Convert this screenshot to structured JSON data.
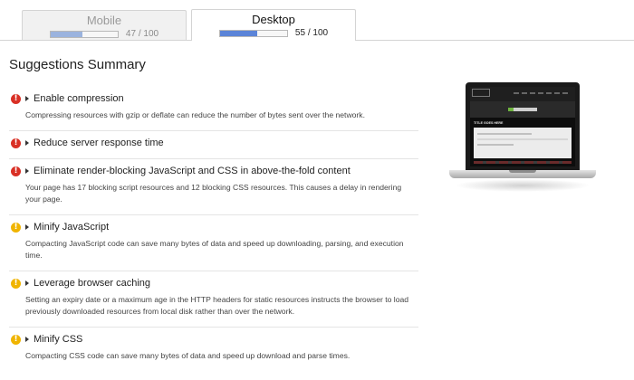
{
  "tabs": [
    {
      "label": "Mobile",
      "score_text": "47 / 100",
      "score": 47,
      "active": false
    },
    {
      "label": "Desktop",
      "score_text": "55 / 100",
      "score": 55,
      "active": true
    }
  ],
  "summary_title": "Suggestions Summary",
  "suggestions": [
    {
      "priority": "high",
      "icon": "!",
      "title": "Enable compression",
      "description": "Compressing resources with gzip or deflate can reduce the number of bytes sent over the network."
    },
    {
      "priority": "high",
      "icon": "!",
      "title": "Reduce server response time",
      "description": ""
    },
    {
      "priority": "high",
      "icon": "!",
      "title": "Eliminate render-blocking JavaScript and CSS in above-the-fold content",
      "description": "Your page has 17 blocking script resources and 12 blocking CSS resources. This causes a delay in rendering your page."
    },
    {
      "priority": "medium",
      "icon": "!",
      "title": "Minify JavaScript",
      "description": "Compacting JavaScript code can save many bytes of data and speed up downloading, parsing, and execution time."
    },
    {
      "priority": "medium",
      "icon": "!",
      "title": "Leverage browser caching",
      "description": "Setting an expiry date or a maximum age in the HTTP headers for static resources instructs the browser to load previously downloaded resources from local disk rather than over the network."
    },
    {
      "priority": "medium",
      "icon": "!",
      "title": "Minify CSS",
      "description": "Compacting CSS code can save many bytes of data and speed up download and parse times."
    }
  ],
  "preview": {
    "screenshot_title": "TITLE GOES HERE",
    "brand": "ORGANIC THEMES"
  },
  "colors": {
    "high_priority": "#d93025",
    "medium_priority": "#f0b400",
    "score_fill": "#5b84d8"
  }
}
